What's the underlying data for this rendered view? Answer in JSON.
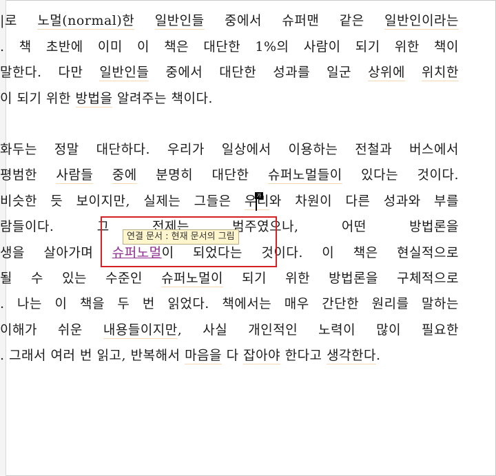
{
  "paragraph1": [
    {
      "segments": [
        {
          "t": "|로 "
        },
        {
          "t": "노멀(normal)한",
          "hl": true
        },
        {
          "t": " "
        },
        {
          "t": "일반인들",
          "hl": true
        },
        {
          "t": " 중에서 슈퍼맨 같은 "
        },
        {
          "t": "일반인이라는",
          "hl": true
        }
      ]
    },
    {
      "segments": [
        {
          "t": ". 책 초반에 이미 이 책은 대단한 1%의 사람이 되기 위한 책이"
        }
      ]
    },
    {
      "segments": [
        {
          "t": " 말한다. 다만 "
        },
        {
          "t": "일반인들",
          "hl": true
        },
        {
          "t": " 중에서 대단한 성과를 일군 "
        },
        {
          "t": "상위에",
          "hl": true
        },
        {
          "t": " "
        },
        {
          "t": "위치한",
          "hl": true
        }
      ]
    },
    {
      "last": true,
      "segments": [
        {
          "t": "이 되기 위한 "
        },
        {
          "t": "방법을",
          "hl": true
        },
        {
          "t": " 알려주는 책이다."
        }
      ]
    }
  ],
  "paragraph2": [
    {
      "segments": [
        {
          "t": " 화두는 정말 대단하다. 우리가 일상에서 이용하는 전철과 버스에서"
        }
      ]
    },
    {
      "segments": [
        {
          "t": " 평범한 "
        },
        {
          "t": "사람들",
          "hl": true
        },
        {
          "t": " "
        },
        {
          "t": "중에",
          "hl": true
        },
        {
          "t": " 분명히 대단한 "
        },
        {
          "t": "슈퍼노멀들이",
          "hl": true
        },
        {
          "t": " 있다는 것이다."
        }
      ]
    },
    {
      "segments": [
        {
          "t": "비슷한 듯 보이지만, 실제는 그들은 "
        },
        {
          "t": "우리",
          "hl": true
        },
        {
          "t": "와 차원이 다른 성과와 부를"
        }
      ]
    },
    {
      "segments": [
        {
          "t": "람들이다. 그 전제는 "
        },
        {
          "t": "         "
        },
        {
          "t": "범주였으나, 어떤 방법론을"
        }
      ]
    },
    {
      "segments": [
        {
          "t": "생을 살아가며 "
        },
        {
          "t": "슈퍼노멀",
          "link": true
        },
        {
          "t": "이 되었다는 것이다. 이 책은 현실적으로"
        }
      ]
    },
    {
      "segments": [
        {
          "t": "될 수 있는 수준인 "
        },
        {
          "t": "슈퍼노멀이",
          "hl": true
        },
        {
          "t": " 되기 위한 방법론을 구체적으로"
        }
      ]
    },
    {
      "segments": [
        {
          "t": ". 나는 이 책을 두 번 읽었다. 책에서는 매우 간단한 원리를 말하는"
        }
      ]
    },
    {
      "segments": [
        {
          "t": " 이해가 쉬운 "
        },
        {
          "t": "내용들이지만",
          "hl": true
        },
        {
          "t": ", 사실 개인적인 노력이 많이 필요한"
        }
      ]
    },
    {
      "last": true,
      "segments": [
        {
          "t": ". 그래서 여러 번 읽고, 반복해서 "
        },
        {
          "t": "마음을",
          "hl": true
        },
        {
          "t": " 다 "
        },
        {
          "t": "잡아야",
          "hl": true
        },
        {
          "t": " 한다고 "
        },
        {
          "t": "생각한다",
          "hl": true
        },
        {
          "t": "."
        }
      ]
    }
  ],
  "tooltip": {
    "text": "연결 문서 : 현재 문서의 그림"
  },
  "cursor_tag": {
    "text": "가"
  }
}
